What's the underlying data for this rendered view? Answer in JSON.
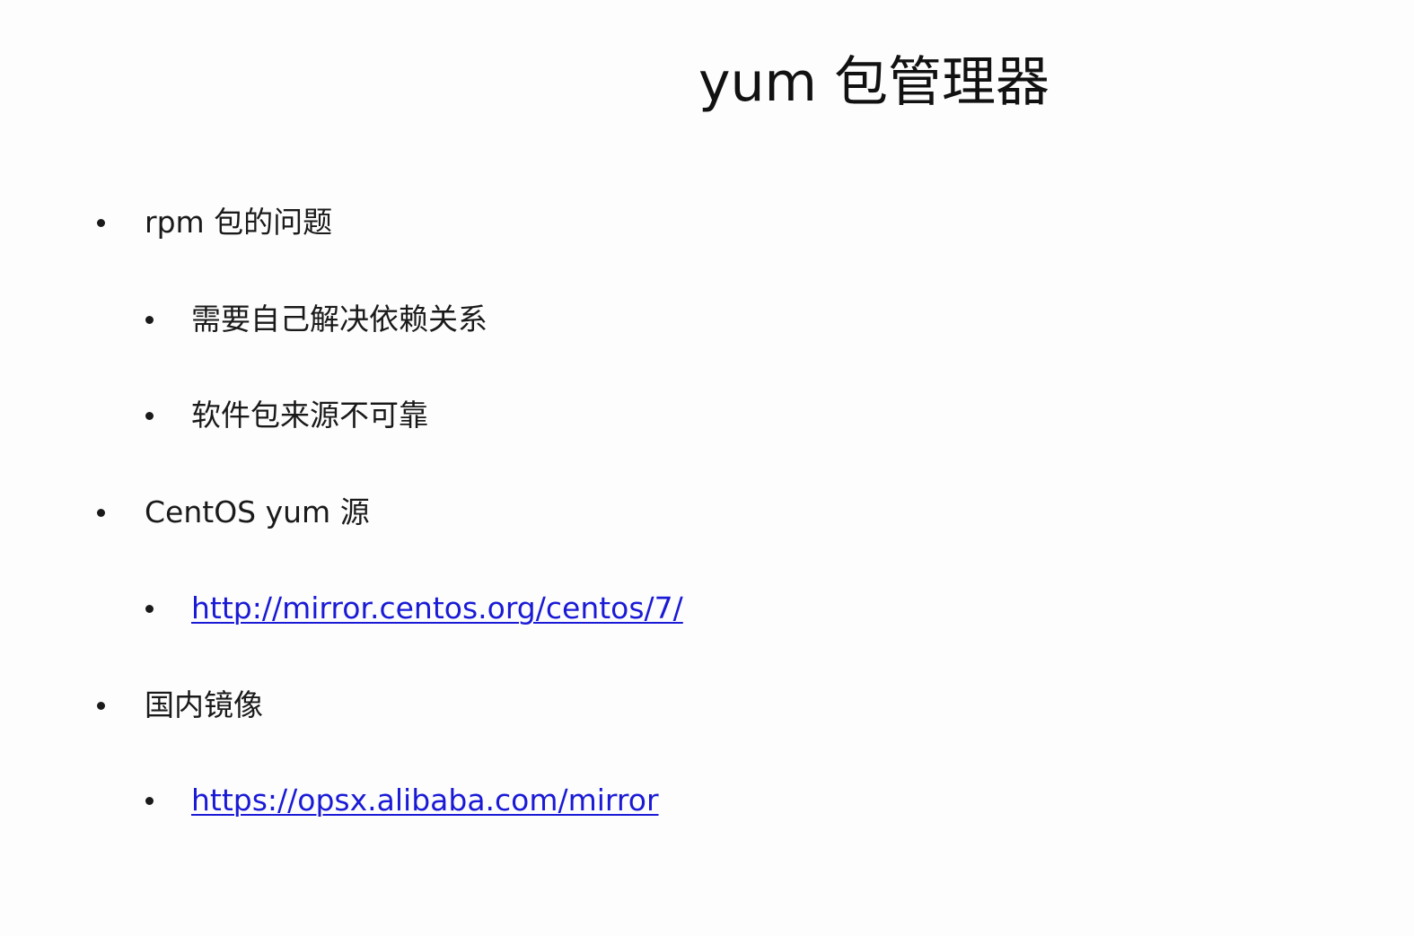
{
  "slide": {
    "title": "yum 包管理器",
    "items": [
      {
        "text": "rpm 包的问题",
        "level": 1
      },
      {
        "text": "需要自己解决依赖关系",
        "level": 2
      },
      {
        "text": "软件包来源不可靠",
        "level": 2
      },
      {
        "text": "CentOS yum 源",
        "level": 1
      },
      {
        "text": "http://mirror.centos.org/centos/7/",
        "level": 2,
        "link": true
      },
      {
        "text": "国内镜像",
        "level": 1
      },
      {
        "text": "https://opsx.alibaba.com/mirror",
        "level": 2,
        "link": true
      }
    ]
  },
  "colors": {
    "background": "#fdfdfd",
    "text": "#1a1a1a",
    "link": "#1a1ad6"
  }
}
